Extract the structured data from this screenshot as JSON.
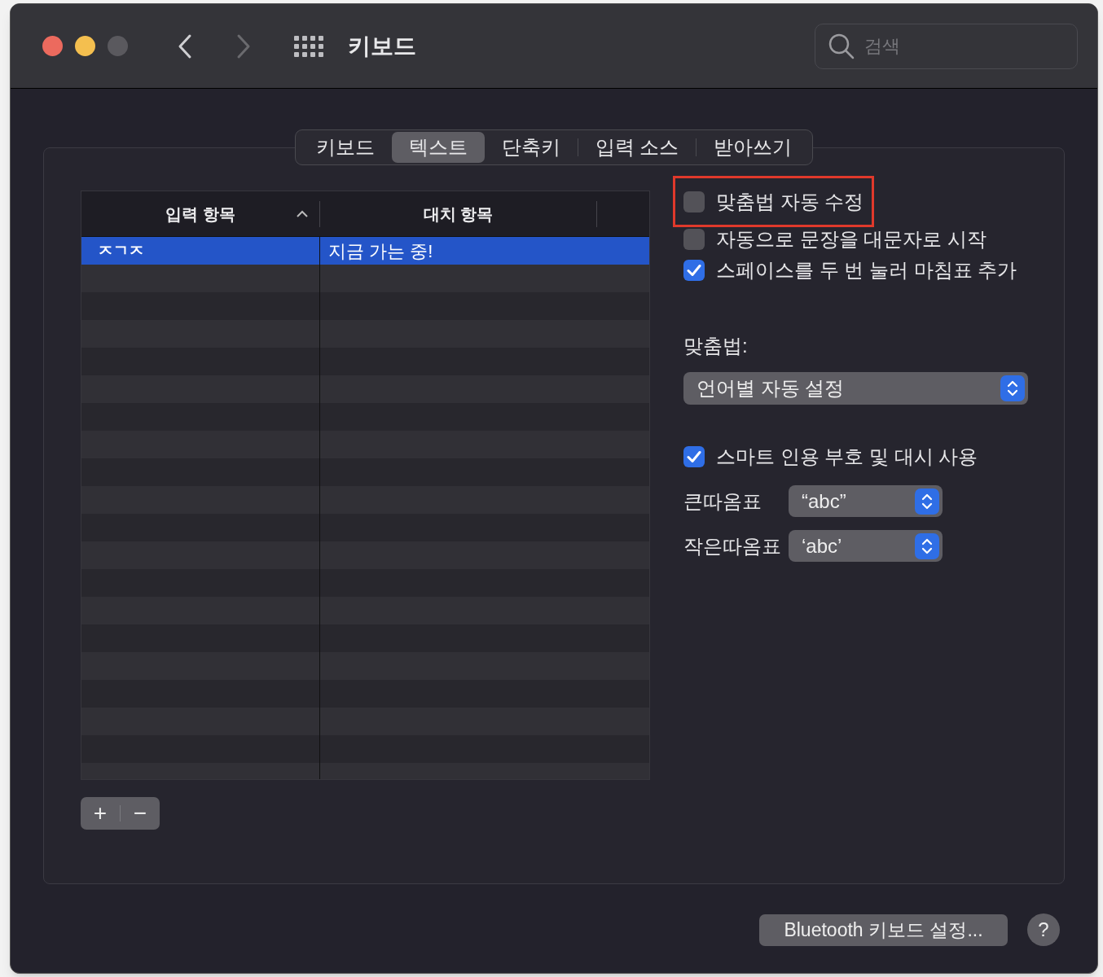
{
  "window": {
    "title": "키보드"
  },
  "search": {
    "placeholder": "검색"
  },
  "tabs": [
    {
      "label": "키보드",
      "selected": false
    },
    {
      "label": "텍스트",
      "selected": true
    },
    {
      "label": "단축키",
      "selected": false
    },
    {
      "label": "입력 소스",
      "selected": false
    },
    {
      "label": "받아쓰기",
      "selected": false
    }
  ],
  "table": {
    "columns": [
      {
        "label": "입력 항목",
        "sorted": true
      },
      {
        "label": "대치 항목",
        "sorted": false
      }
    ],
    "rows": [
      {
        "input": "ㅈㄱㅈ",
        "replacement": "지금 가는 중!",
        "selected": true
      }
    ]
  },
  "table_buttons": [
    "+",
    "−"
  ],
  "options": [
    {
      "label": "맞춤법 자동 수정",
      "checked": false,
      "highlighted": true
    },
    {
      "label": "자동으로 문장을 대문자로 시작",
      "checked": false,
      "highlighted": false
    },
    {
      "label": "스페이스를 두 번 눌러 마침표 추가",
      "checked": true,
      "highlighted": false
    }
  ],
  "spelling": {
    "label": "맞춤법:",
    "value": "언어별 자동 설정"
  },
  "smart_quotes": {
    "label": "스마트 인용 부호 및 대시 사용",
    "checked": true
  },
  "quote_popups": [
    {
      "label": "큰따옴표",
      "value": "“abc”"
    },
    {
      "label": "작은따옴표",
      "value": "‘abc’"
    }
  ],
  "bluetooth_button": "Bluetooth 키보드 설정...",
  "help_button": "?"
}
